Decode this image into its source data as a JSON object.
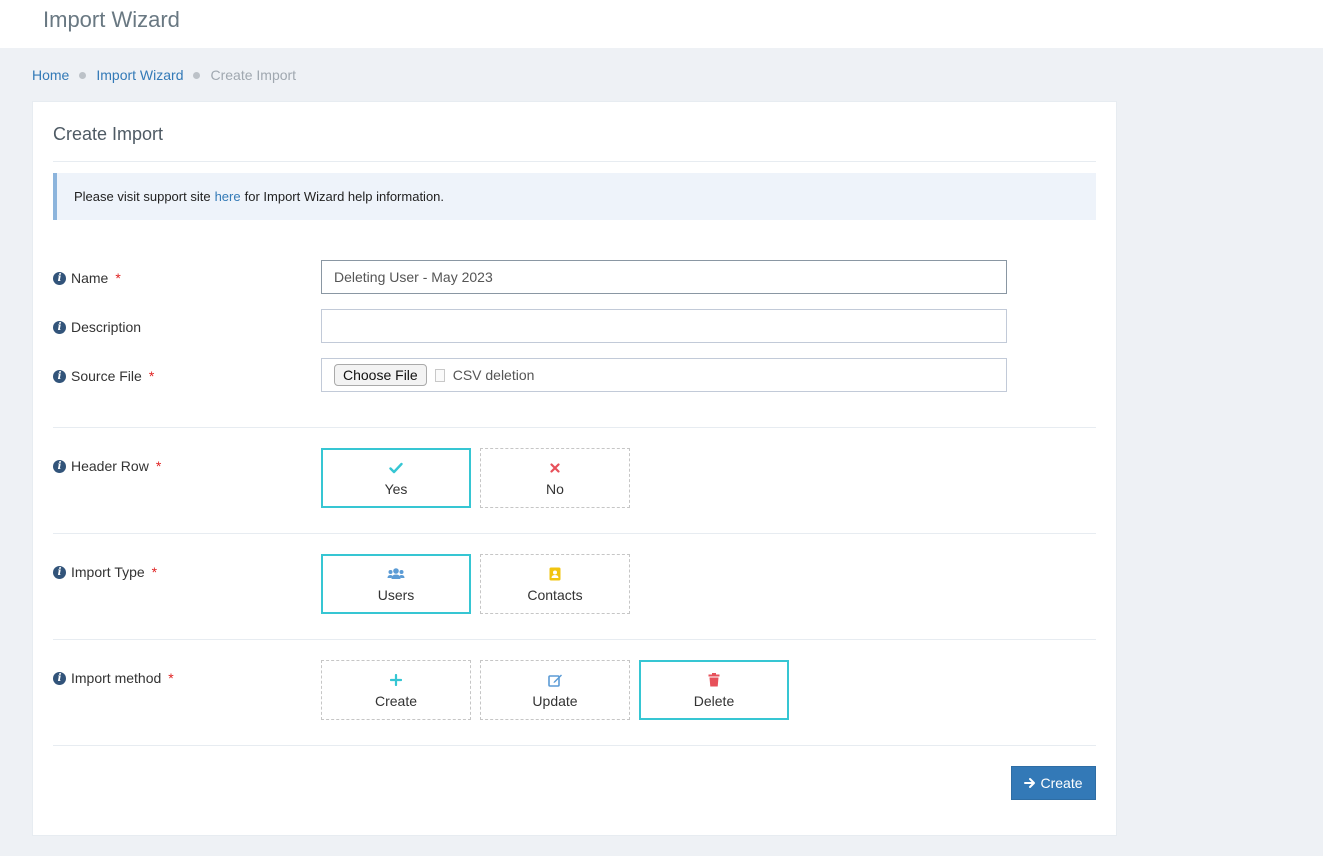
{
  "header": {
    "title": "Import Wizard"
  },
  "breadcrumb": {
    "home": "Home",
    "wizard": "Import Wizard",
    "current": "Create Import"
  },
  "portlet": {
    "title": "Create Import"
  },
  "note": {
    "before": "Please visit support site",
    "link": "here",
    "after": "for Import Wizard help information."
  },
  "form": {
    "name": {
      "label": "Name",
      "required": "*",
      "value": "Deleting User - May 2023"
    },
    "description": {
      "label": "Description",
      "value": ""
    },
    "source_file": {
      "label": "Source File",
      "required": "*",
      "button": "Choose File",
      "filename": "CSV deletion"
    },
    "header_row": {
      "label": "Header Row",
      "required": "*",
      "options": [
        {
          "label": "Yes",
          "icon": "check-icon",
          "selected": true
        },
        {
          "label": "No",
          "icon": "x-icon",
          "selected": false
        }
      ]
    },
    "import_type": {
      "label": "Import Type",
      "required": "*",
      "options": [
        {
          "label": "Users",
          "icon": "users-icon",
          "selected": true
        },
        {
          "label": "Contacts",
          "icon": "contact-card-icon",
          "selected": false
        }
      ]
    },
    "import_method": {
      "label": "Import method",
      "required": "*",
      "options": [
        {
          "label": "Create",
          "icon": "plus-icon",
          "selected": false
        },
        {
          "label": "Update",
          "icon": "edit-icon",
          "selected": false
        },
        {
          "label": "Delete",
          "icon": "trash-icon",
          "selected": true
        }
      ]
    }
  },
  "actions": {
    "create_label": "Create"
  },
  "colors": {
    "accent": "#36c6d3",
    "primary": "#3379b7",
    "required": "#e02222",
    "link": "#337ab7"
  }
}
